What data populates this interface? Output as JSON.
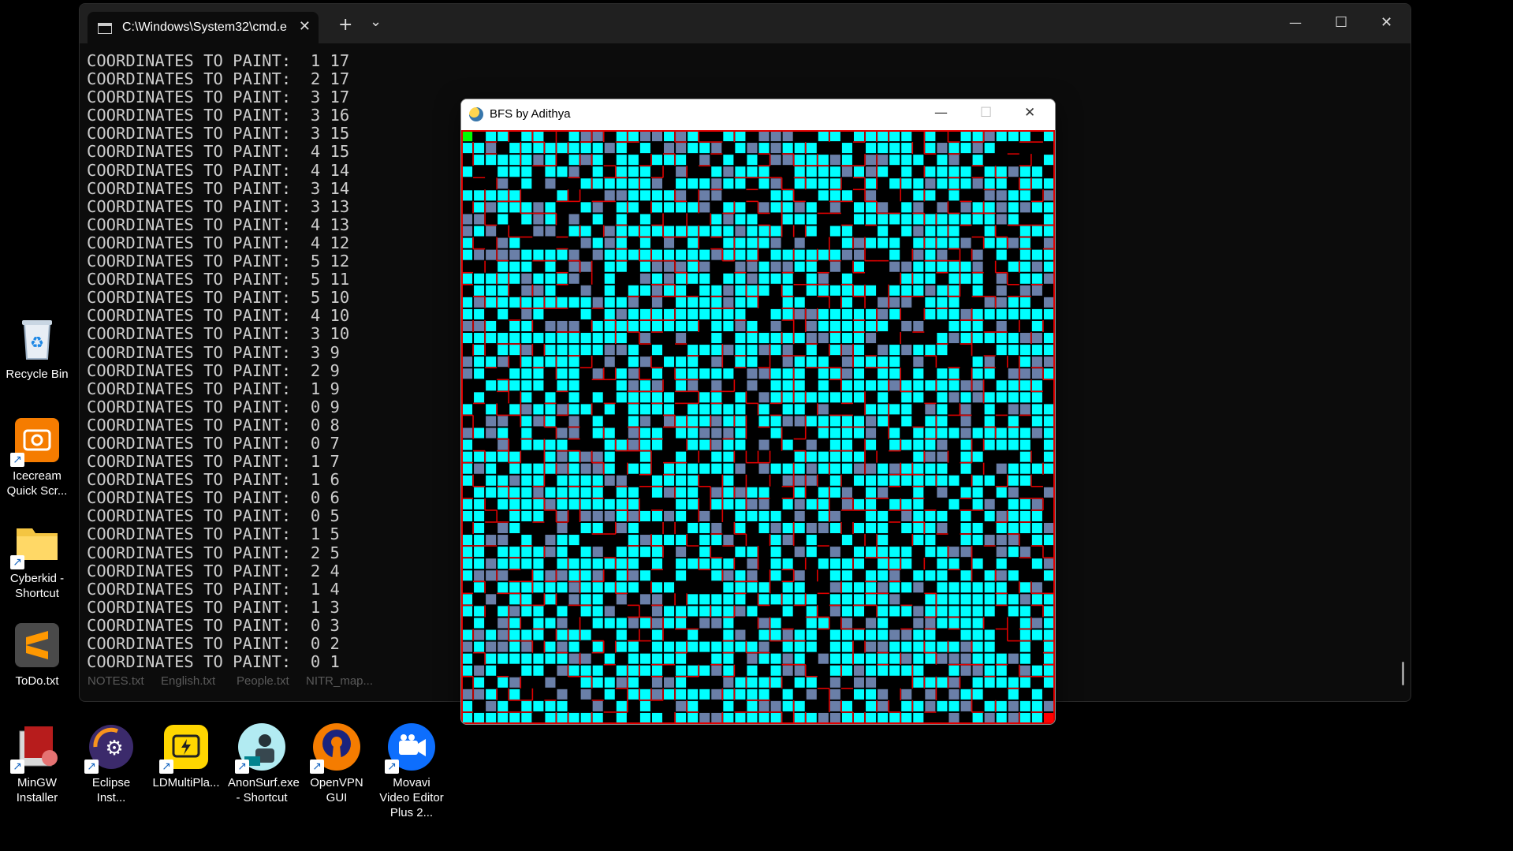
{
  "desktop": {
    "icons": [
      {
        "label": "Recycle Bin",
        "icon": "recycle-bin-icon"
      },
      {
        "label": "Icecream Quick Scr...",
        "icon": "icecream-screen-recorder-icon"
      },
      {
        "label": "Cyberkid - Shortcut",
        "icon": "folder-icon"
      },
      {
        "label": "ToDo.txt",
        "icon": "sublime-text-icon"
      },
      {
        "label": "MinGW Installer",
        "icon": "mingw-installer-icon"
      },
      {
        "label": "Eclipse Inst...",
        "icon": "eclipse-installer-icon"
      },
      {
        "label": "LDMultiPla...",
        "icon": "ldmultiplayer-icon"
      },
      {
        "label": "AnonSurf.exe - Shortcut",
        "icon": "anonsurf-icon"
      },
      {
        "label": "OpenVPN GUI",
        "icon": "openvpn-icon"
      },
      {
        "label": "Movavi Video Editor Plus 2...",
        "icon": "movavi-icon"
      }
    ]
  },
  "terminal": {
    "tab_title": "C:\\Windows\\System32\\cmd.e",
    "new_tab": "+",
    "dropdown": "⌄",
    "minimize": "—",
    "maximize": "☐",
    "close": "✕",
    "lines": [
      "COORDINATES TO PAINT:  1 17",
      "COORDINATES TO PAINT:  2 17",
      "COORDINATES TO PAINT:  3 17",
      "COORDINATES TO PAINT:  3 16",
      "COORDINATES TO PAINT:  3 15",
      "COORDINATES TO PAINT:  4 15",
      "COORDINATES TO PAINT:  4 14",
      "COORDINATES TO PAINT:  3 14",
      "COORDINATES TO PAINT:  3 13",
      "COORDINATES TO PAINT:  4 13",
      "COORDINATES TO PAINT:  4 12",
      "COORDINATES TO PAINT:  5 12",
      "COORDINATES TO PAINT:  5 11",
      "COORDINATES TO PAINT:  5 10",
      "COORDINATES TO PAINT:  4 10",
      "COORDINATES TO PAINT:  3 10",
      "COORDINATES TO PAINT:  3 9",
      "COORDINATES TO PAINT:  2 9",
      "COORDINATES TO PAINT:  1 9",
      "COORDINATES TO PAINT:  0 9",
      "COORDINATES TO PAINT:  0 8",
      "COORDINATES TO PAINT:  0 7",
      "COORDINATES TO PAINT:  1 7",
      "COORDINATES TO PAINT:  1 6",
      "COORDINATES TO PAINT:  0 6",
      "COORDINATES TO PAINT:  0 5",
      "COORDINATES TO PAINT:  1 5",
      "COORDINATES TO PAINT:  2 5",
      "COORDINATES TO PAINT:  2 4",
      "COORDINATES TO PAINT:  1 4",
      "COORDINATES TO PAINT:  1 3",
      "COORDINATES TO PAINT:  0 3",
      "COORDINATES TO PAINT:  0 2",
      "COORDINATES TO PAINT:  0 1"
    ],
    "ghost_labels": [
      "NOTES.txt",
      "English.txt",
      "People.txt",
      "NITR_map..."
    ]
  },
  "bfs_window": {
    "title": "BFS by Adithya",
    "minimize": "—",
    "maximize": "☐",
    "close": "✕",
    "colors": {
      "visited": "#00ffff",
      "path": "#6a7fa8",
      "empty": "#000000",
      "wall": "#e00000",
      "start": "#00ff00",
      "end": "#ff0000"
    }
  }
}
